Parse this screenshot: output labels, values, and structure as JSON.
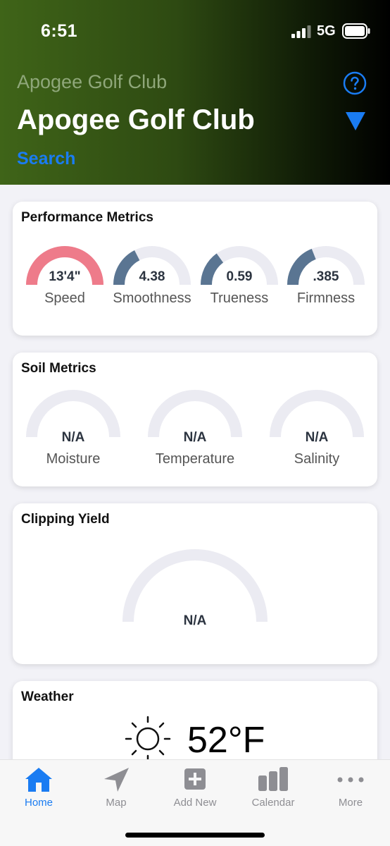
{
  "status_bar": {
    "time": "6:51",
    "network": "5G"
  },
  "header": {
    "subtitle": "Apogee Golf Club",
    "title": "Apogee Golf Club",
    "search_label": "Search"
  },
  "performance": {
    "title": "Performance Metrics",
    "gauges": [
      {
        "value": "13'4\"",
        "label": "Speed",
        "fill": 1.0,
        "color": "#ee7b8a"
      },
      {
        "value": "4.38",
        "label": "Smoothness",
        "fill": 0.35,
        "color": "#5a7592"
      },
      {
        "value": "0.59",
        "label": "Trueness",
        "fill": 0.3,
        "color": "#5a7592"
      },
      {
        "value": ".385",
        "label": "Firmness",
        "fill": 0.38,
        "color": "#5a7592"
      }
    ]
  },
  "soil": {
    "title": "Soil Metrics",
    "gauges": [
      {
        "value": "N/A",
        "label": "Moisture"
      },
      {
        "value": "N/A",
        "label": "Temperature"
      },
      {
        "value": "N/A",
        "label": "Salinity"
      }
    ]
  },
  "clipping": {
    "title": "Clipping Yield",
    "value": "N/A"
  },
  "weather": {
    "title": "Weather",
    "temperature": "52°F",
    "icon": "sun-icon"
  },
  "tabbar": {
    "items": [
      {
        "label": "Home",
        "icon": "home-icon",
        "active": true
      },
      {
        "label": "Map",
        "icon": "navigation-arrow-icon",
        "active": false
      },
      {
        "label": "Add New",
        "icon": "plus-square-icon",
        "active": false
      },
      {
        "label": "Calendar",
        "icon": "bar-chart-icon",
        "active": false
      },
      {
        "label": "More",
        "icon": "more-dots-icon",
        "active": false
      }
    ]
  },
  "colors": {
    "accent": "#1a7cf2",
    "gauge_track": "#ebebf2",
    "speed_gauge": "#ee7b8a",
    "metric_gauge": "#5a7592"
  }
}
